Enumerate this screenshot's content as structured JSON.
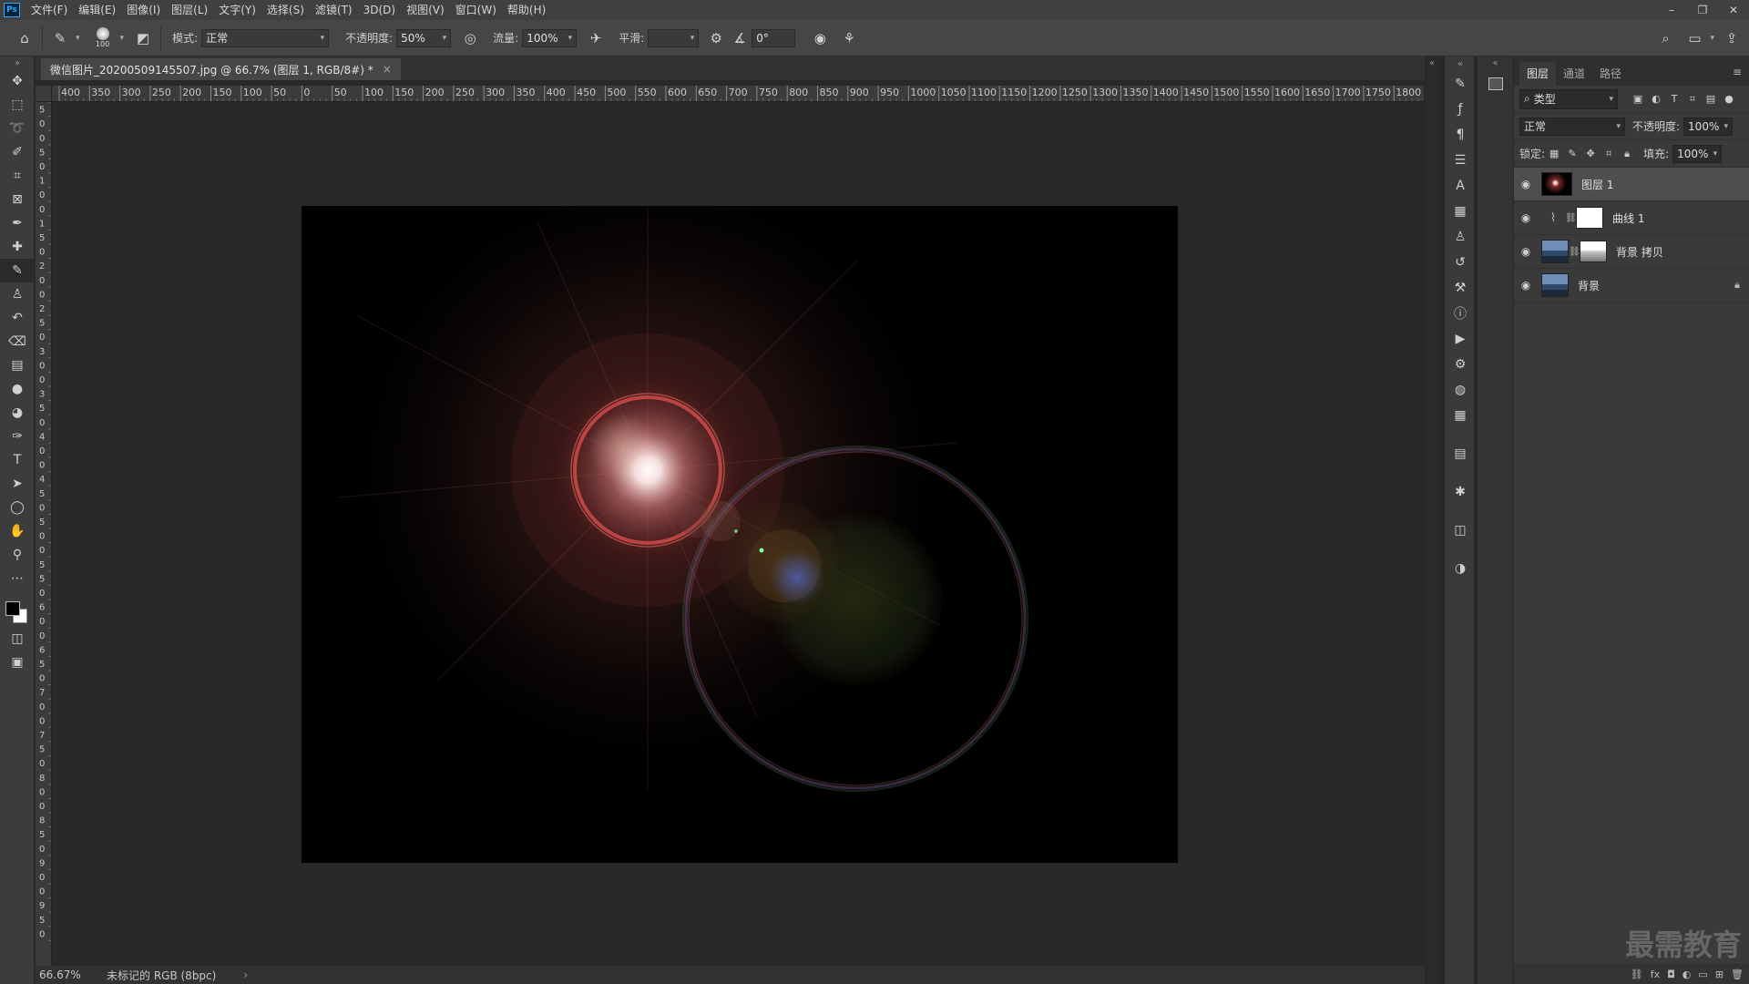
{
  "app": {
    "logo_text": "Ps"
  },
  "menu": [
    "文件(F)",
    "编辑(E)",
    "图像(I)",
    "图层(L)",
    "文字(Y)",
    "选择(S)",
    "滤镜(T)",
    "3D(D)",
    "视图(V)",
    "窗口(W)",
    "帮助(H)"
  ],
  "window_controls": {
    "minimize": "–",
    "restore": "❐",
    "close": "✕"
  },
  "options": {
    "brush_size": "100",
    "mode_label": "模式:",
    "mode_value": "正常",
    "opacity_label": "不透明度:",
    "opacity_value": "50%",
    "flow_label": "流量:",
    "flow_value": "100%",
    "smoothing_label": "平滑:",
    "smoothing_value": "",
    "angle_value": "0°"
  },
  "document": {
    "tab_title": "微信图片_20200509145507.jpg @ 66.7% (图层 1, RGB/8#) *",
    "close": "×"
  },
  "ruler": {
    "top_labels": [
      "400",
      "350",
      "300",
      "250",
      "200",
      "150",
      "100",
      "50",
      "0",
      "50",
      "100",
      "150",
      "200",
      "250",
      "300",
      "350",
      "400",
      "450",
      "500",
      "550",
      "600",
      "650",
      "700",
      "750",
      "800",
      "850",
      "900",
      "950",
      "1000",
      "1050",
      "1100",
      "1150",
      "1200",
      "1250",
      "1300",
      "1350",
      "1400",
      "1450",
      "1500",
      "1550",
      "1600",
      "1650",
      "1700",
      "1750",
      "1800"
    ],
    "left_labels": [
      "0",
      "5",
      "0",
      "0",
      "5",
      "0",
      "1",
      "0",
      "0",
      "1",
      "5",
      "0",
      "2",
      "0",
      "0",
      "2",
      "5",
      "0",
      "3",
      "0",
      "0",
      "3",
      "5",
      "0",
      "4",
      "0",
      "0",
      "4",
      "5",
      "0",
      "5",
      "0",
      "0",
      "5",
      "5",
      "0",
      "6",
      "0",
      "0",
      "6",
      "5",
      "0",
      "7",
      "0",
      "0",
      "7",
      "5",
      "0",
      "8",
      "0",
      "0",
      "8",
      "5",
      "0",
      "9",
      "0",
      "0",
      "9",
      "5",
      "0"
    ]
  },
  "status": {
    "zoom": "66.67%",
    "profile": "未标记的 RGB (8bpc)",
    "arrow": "›"
  },
  "layers_panel": {
    "tabs": [
      "图层",
      "通道",
      "路径"
    ],
    "filter_value": "类型",
    "blend_mode": "正常",
    "opacity_label": "不透明度:",
    "opacity_value": "100%",
    "lock_label": "锁定:",
    "fill_label": "填充:",
    "fill_value": "100%",
    "layers": [
      {
        "name": "图层 1",
        "selected": true
      },
      {
        "name": "曲线 1",
        "selected": false
      },
      {
        "name": "背景 拷贝",
        "selected": false
      },
      {
        "name": "背景",
        "selected": false
      }
    ]
  },
  "watermark": "最需教育",
  "colors": {
    "accent": "#31a8ff",
    "panel": "#3a3a3a",
    "workspace": "#282828",
    "foreground": "#000000",
    "background": "#ffffff"
  }
}
